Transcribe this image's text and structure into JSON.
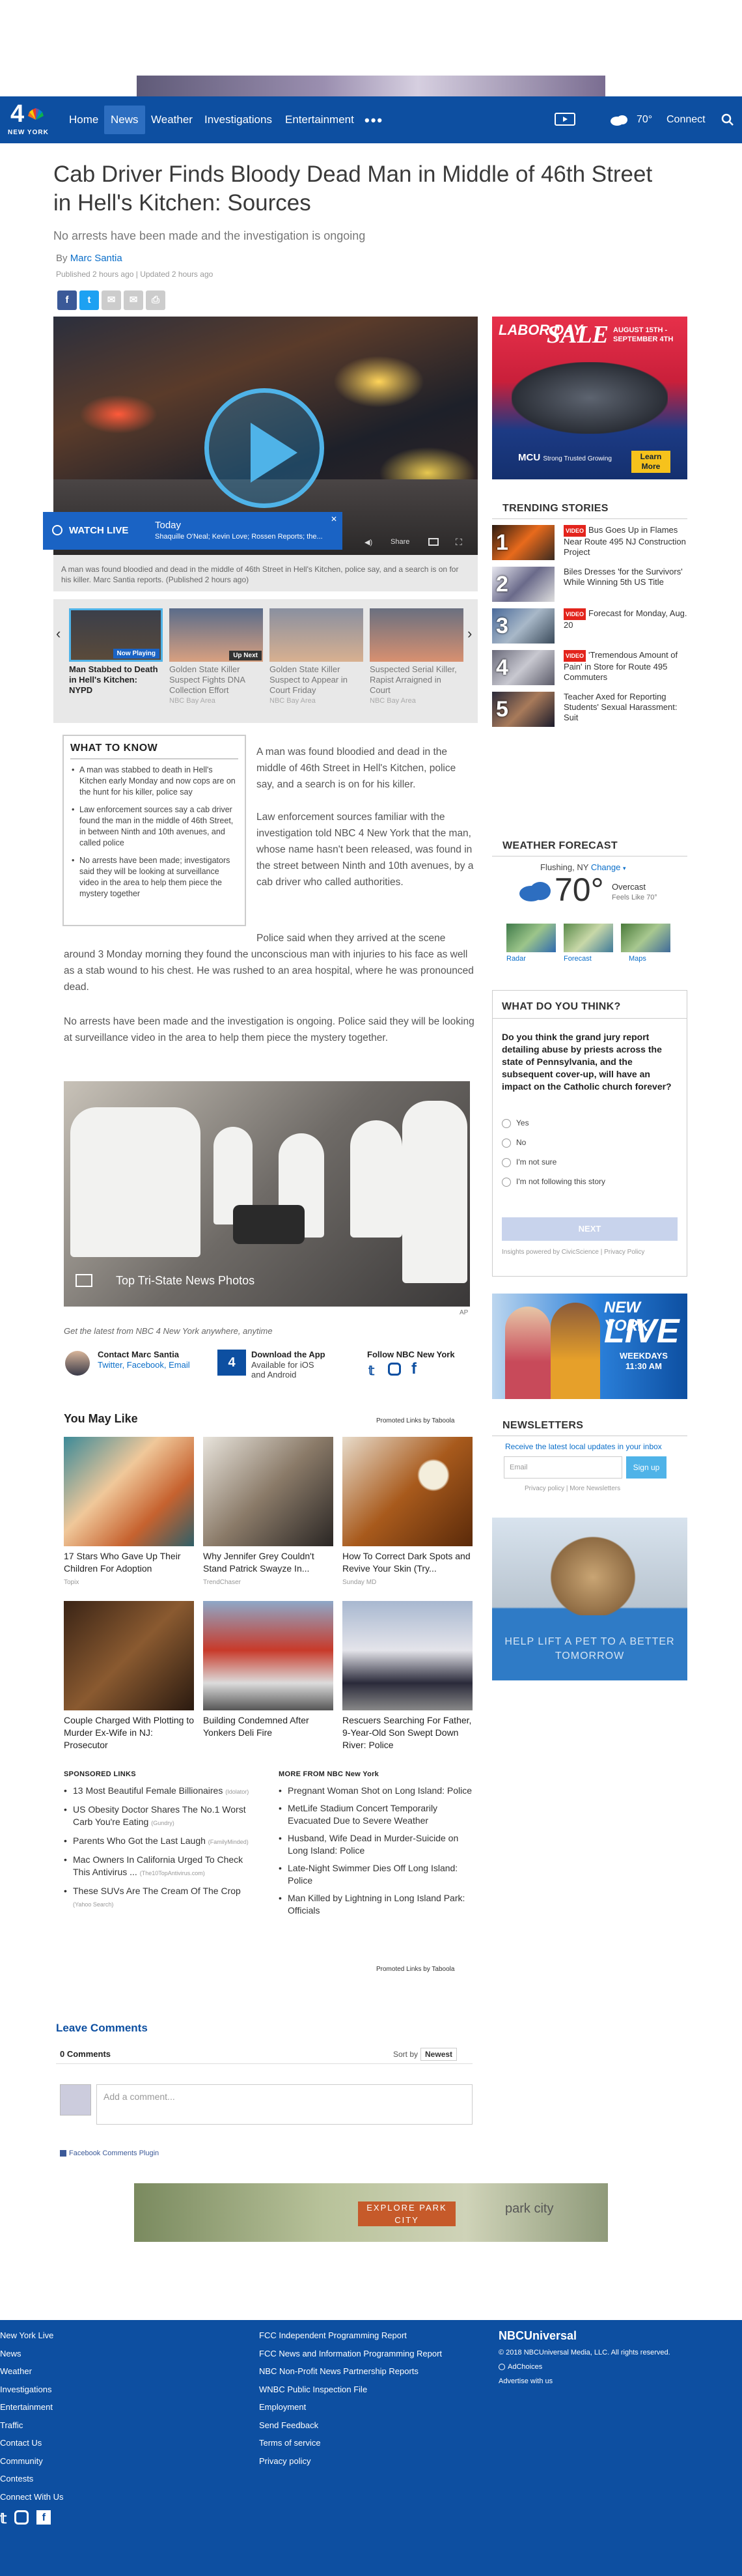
{
  "top_ad": {},
  "nav": {
    "logo_number": "4",
    "logo_sub": "NEW YORK",
    "items": [
      "Home",
      "News",
      "Weather",
      "Investigations",
      "Entertainment"
    ],
    "more": "•••",
    "temp": "70°",
    "connect": "Connect",
    "colors": {
      "bar": "#0d4fa1",
      "active": "#2d6ec0"
    }
  },
  "article": {
    "headline": "Cab Driver Finds Bloody Dead Man in Middle of 46th Street in Hell's Kitchen: Sources",
    "dek": "No arrests have been made and the investigation is ongoing",
    "by": "By",
    "author": "Marc Santia",
    "published": "Published 2 hours ago | Updated 2 hours ago",
    "share_buttons": [
      "f",
      "t",
      "✉",
      "✉",
      "⎙"
    ]
  },
  "video": {
    "watch_live": "WATCH LIVE",
    "today": "Today",
    "shows": "Shaquille O'Neal; Kevin Love; Rossen Reports; the...",
    "close": "✕",
    "controls": {
      "share": "Share"
    },
    "caption": "A man was found bloodied and dead in the middle of 46th Street in Hell's Kitchen, police say, and a search is on for his killer. Marc Santia reports. (Published 2 hours ago)"
  },
  "carousel": {
    "items": [
      {
        "badge": "Now Playing",
        "title": "Man Stabbed to Death in Hell's Kitchen: NYPD",
        "source": "",
        "active": true
      },
      {
        "badge": "Up Next",
        "title": "Golden State Killer Suspect Fights DNA Collection Effort",
        "source": "NBC Bay Area",
        "active": false
      },
      {
        "badge": "",
        "title": "Golden State Killer Suspect to Appear in Court Friday",
        "source": "NBC Bay Area",
        "active": false
      },
      {
        "badge": "",
        "title": "Suspected Serial Killer, Rapist Arraigned in Court",
        "source": "NBC Bay Area",
        "active": false
      }
    ],
    "prev": "‹",
    "next": "›"
  },
  "what_to_know": {
    "title": "WHAT TO KNOW",
    "items": [
      "A man was stabbed to death in Hell's Kitchen early Monday and now cops are on the hunt for his killer, police say",
      "Law enforcement sources say a cab driver found the man in the middle of 46th Street, in between Ninth and 10th avenues, and called police",
      "No arrests have been made; investigators said they will be looking at surveillance video in the area to help them piece the mystery together"
    ]
  },
  "body": {
    "p1": "A man was found bloodied and dead in the middle of 46th Street in Hell's Kitchen, police say, and a search is on for his killer.",
    "p2": "Law enforcement sources familiar with the investigation told NBC 4 New York that the man, whose name hasn't been released, was found in the street between Ninth and 10th avenues, by a cab driver who called authorities.",
    "p3a": "Police said when they arrived at the scene",
    "p3b": "around 3 Monday morning they found the unconscious man with injuries to his face as well as a stab wound to his chest. He was rushed to an area hospital, where he was pronounced dead.",
    "p4": "No arrests have been made and the investigation is ongoing. Police said they will be looking at surveillance video in the area to help them piece the mystery together."
  },
  "slideshow": {
    "label": "Top Tri-State News Photos",
    "credit": "AP"
  },
  "get_latest": "Get the latest from NBC 4 New York anywhere, anytime",
  "contact": {
    "title": "Contact Marc Santia",
    "links": "Twitter, Facebook, Email",
    "app_title": "Download the App",
    "app_sub": "Available for iOS and Android",
    "follow": "Follow NBC New York"
  },
  "you_may_like": {
    "title": "You May Like",
    "promoted": "Promoted Links by Taboola",
    "items": [
      {
        "title": "17 Stars Who Gave Up Their Children For Adoption",
        "source": "Topix"
      },
      {
        "title": "Why Jennifer Grey Couldn't Stand Patrick Swayze In...",
        "source": "TrendChaser"
      },
      {
        "title": "How To Correct Dark Spots and Revive Your Skin (Try...",
        "source": "Sunday MD"
      },
      {
        "title": "Couple Charged With Plotting to Murder Ex-Wife in NJ: Prosecutor",
        "source": ""
      },
      {
        "title": "Building Condemned After Yonkers Deli Fire",
        "source": ""
      },
      {
        "title": "Rescuers Searching For Father, 9-Year-Old Son Swept Down River: Police",
        "source": ""
      }
    ]
  },
  "sponsored": {
    "title": "SPONSORED LINKS",
    "items": [
      {
        "text": "13 Most Beautiful Female Billionaires",
        "src": "(Idolator)"
      },
      {
        "text": "US Obesity Doctor Shares The No.1 Worst Carb You're Eating",
        "src": "(Gundry)"
      },
      {
        "text": "Parents Who Got the Last Laugh",
        "src": "(FamilyMinded)"
      },
      {
        "text": "Mac Owners In California Urged To Check This Antivirus ...",
        "src": "(The10TopAntivirus.com)"
      },
      {
        "text": "These SUVs Are The Cream Of The Crop",
        "src": "(Yahoo Search)"
      }
    ]
  },
  "more_from": {
    "title": "MORE FROM NBC New York",
    "items": [
      "Pregnant Woman Shot on Long Island: Police",
      "MetLife Stadium Concert Temporarily Evacuated Due to Severe Weather",
      "Husband, Wife Dead in Murder-Suicide on Long Island: Police",
      "Late-Night Swimmer Dies Off Long Island: Police",
      "Man Killed by Lightning in Long Island Park: Officials"
    ]
  },
  "comments": {
    "title": "Leave Comments",
    "count": "0 Comments",
    "sort_label": "Sort by",
    "sort_value": "Newest",
    "placeholder": "Add a comment...",
    "plugin": "Facebook Comments Plugin"
  },
  "bottom_ad": {
    "cta": "EXPLORE PARK CITY",
    "brand": "park city"
  },
  "sidebar": {
    "ad": {
      "ld": "LABOR DAY",
      "sale": "SALE",
      "dates": "AUGUST 15TH - SEPTEMBER 4TH",
      "mcu": "MCU",
      "mcu_sub": "Strong Trusted Growing",
      "learn": "Learn More"
    },
    "trending_title": "TRENDING STORIES",
    "trending": [
      {
        "num": "1",
        "video": true,
        "text": "Bus Goes Up in Flames Near Route 495 NJ Construction Project"
      },
      {
        "num": "2",
        "video": false,
        "text": "Biles Dresses 'for the Survivors' While Winning 5th US Title"
      },
      {
        "num": "3",
        "video": true,
        "text": "Forecast for Monday, Aug. 20"
      },
      {
        "num": "4",
        "video": true,
        "text": "'Tremendous Amount of Pain' in Store for Route 495 Commuters"
      },
      {
        "num": "5",
        "video": false,
        "text": "Teacher Axed for Reporting Students' Sexual Harassment: Suit"
      }
    ],
    "video_badge": "VIDEO",
    "weather": {
      "title": "WEATHER FORECAST",
      "location": "Flushing, NY",
      "change": "Change",
      "temp": "70°",
      "condition": "Overcast",
      "feels": "Feels Like 70°",
      "tabs": [
        "Radar",
        "Forecast",
        "Maps"
      ]
    },
    "poll": {
      "title": "WHAT DO YOU THINK?",
      "question": "Do you think the grand jury report detailing abuse by priests across the state of Pennsylvania, and the subsequent cover-up, will have an impact on the Catholic church forever?",
      "options": [
        "Yes",
        "No",
        "I'm not sure",
        "I'm not following this story"
      ],
      "next": "NEXT",
      "footer": "Insights powered by CivicScience | Privacy Policy"
    },
    "nylive": {
      "new": "NEW YORK",
      "live": "LIVE",
      "when": "WEEKDAYS 11:30 AM"
    },
    "newsletters": {
      "title": "NEWSLETTERS",
      "sub": "Receive the latest local updates in your inbox",
      "email_placeholder": "Email",
      "signup": "Sign up",
      "links": "Privacy policy | More Newsletters"
    },
    "pet_ad": {
      "text": "HELP LIFT A PET TO A BETTER TOMORROW"
    }
  },
  "footer": {
    "col1": [
      "New York Live",
      "News",
      "Weather",
      "Investigations",
      "Entertainment",
      "Traffic",
      "Contact Us",
      "Community",
      "Contests",
      "Connect With Us"
    ],
    "col2": [
      "FCC Independent Programming Report",
      "FCC News and Information Programming Report",
      "NBC Non-Profit News Partnership Reports",
      "WNBC Public Inspection File",
      "Employment",
      "Send Feedback",
      "Terms of service",
      "Privacy policy"
    ],
    "brand": "NBCUniversal",
    "copyright": "© 2018 NBCUniversal Media, LLC. All rights reserved.",
    "adchoices": "AdChoices",
    "advertise": "Advertise with us"
  }
}
